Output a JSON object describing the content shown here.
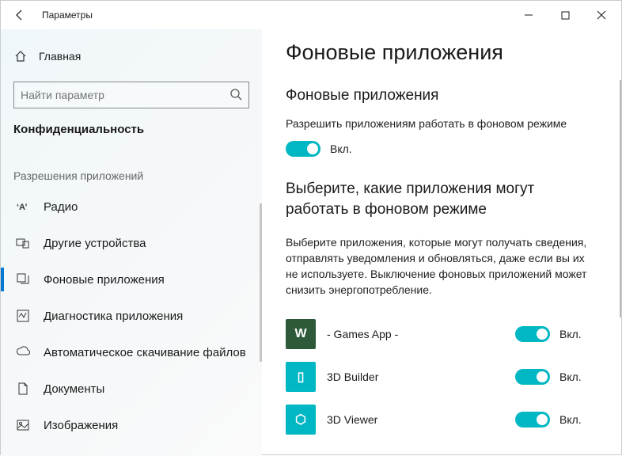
{
  "window": {
    "title": "Параметры"
  },
  "sidebar": {
    "home_label": "Главная",
    "search_placeholder": "Найти параметр",
    "current_section": "Конфиденциальность",
    "group_label": "Разрешения приложений",
    "items": [
      {
        "label": "Радио"
      },
      {
        "label": "Другие устройства"
      },
      {
        "label": "Фоновые приложения",
        "selected": true
      },
      {
        "label": "Диагностика приложения"
      },
      {
        "label": "Автоматическое скачивание файлов"
      },
      {
        "label": "Документы"
      },
      {
        "label": "Изображения"
      }
    ]
  },
  "content": {
    "title": "Фоновые приложения",
    "section1_heading": "Фоновые приложения",
    "section1_desc": "Разрешить приложениям работать в фоновом режиме",
    "master_toggle_label": "Вкл.",
    "section2_heading": "Выберите, какие приложения могут работать в фоновом режиме",
    "section2_desc": "Выберите приложения, которые могут получать сведения, отправлять уведомления и обновляться, даже если вы их не используете. Выключение фоновых приложений может снизить энергопотребление.",
    "apps": [
      {
        "name": "- Games App -",
        "icon_bg": "#2e5a3a",
        "icon_letter": "W",
        "toggle_label": "Вкл."
      },
      {
        "name": "3D Builder",
        "icon_bg": "#00b7c3",
        "icon_letter": "▯",
        "toggle_label": "Вкл."
      },
      {
        "name": "3D Viewer",
        "icon_bg": "#00b7c3",
        "icon_letter": "⬡",
        "toggle_label": "Вкл."
      }
    ]
  }
}
